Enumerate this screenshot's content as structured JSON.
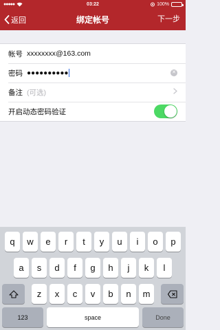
{
  "status_bar": {
    "time": "03:22",
    "battery_percent": "100%",
    "battery_level": 1.0
  },
  "nav": {
    "back_label": "返回",
    "title": "绑定帐号",
    "next_label": "下一步"
  },
  "form": {
    "account_label": "帐号",
    "account_value": "xxxxxxxx@163.com",
    "password_label": "密码",
    "password_value": "●●●●●●●●●●",
    "note_label": "备注",
    "note_placeholder": "(可选)",
    "dynamic_label": "开启动态密码验证",
    "dynamic_enabled": true
  },
  "keyboard": {
    "row1": [
      "q",
      "w",
      "e",
      "r",
      "t",
      "y",
      "u",
      "i",
      "o",
      "p"
    ],
    "row2": [
      "a",
      "s",
      "d",
      "f",
      "g",
      "h",
      "j",
      "k",
      "l"
    ],
    "row3": [
      "z",
      "x",
      "c",
      "v",
      "b",
      "n",
      "m"
    ],
    "num_label": "123",
    "space_label": "space",
    "done_label": "Done"
  },
  "colors": {
    "accent": "#b3272b",
    "toggle_on": "#4cd964"
  }
}
